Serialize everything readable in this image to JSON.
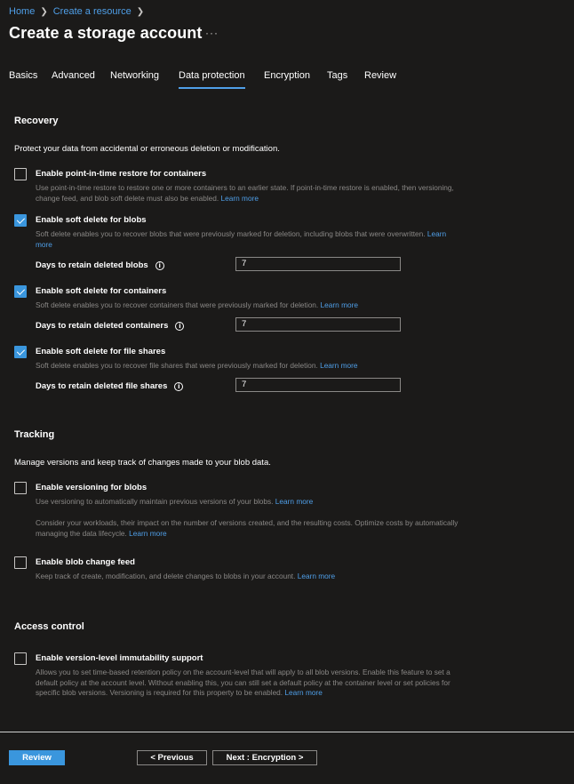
{
  "breadcrumb": {
    "items": [
      "Home",
      "Create a resource"
    ]
  },
  "page": {
    "title": "Create a storage account",
    "more_label": "···"
  },
  "tabs": [
    {
      "label": "Basics"
    },
    {
      "label": "Advanced"
    },
    {
      "label": "Networking"
    },
    {
      "label": "Data protection",
      "active": true
    },
    {
      "label": "Encryption"
    },
    {
      "label": "Tags"
    },
    {
      "label": "Review"
    }
  ],
  "recovery": {
    "heading": "Recovery",
    "description": "Protect your data from accidental or erroneous deletion or modification.",
    "pitr": {
      "label": "Enable point-in-time restore for containers",
      "checked": false,
      "help_line1": "Use point-in-time restore to restore one or more containers to an earlier state. If point-in-time restore is enabled, then versioning,",
      "help_line2": "change feed, and blob soft delete must also be enabled.",
      "learn_more": "Learn more"
    },
    "soft_delete_blobs": {
      "label": "Enable soft delete for blobs",
      "checked": true,
      "help_line1": "Soft delete enables you to recover blobs that were previously marked for deletion, including blobs that were overwritten.",
      "learn_more_1": "Learn",
      "learn_more_2": "more",
      "days_label": "Days to retain deleted blobs",
      "days_value": "7"
    },
    "soft_delete_containers": {
      "label": "Enable soft delete for containers",
      "checked": true,
      "help_line1": "Soft delete enables you to recover containers that were previously marked for deletion.",
      "learn_more": "Learn more",
      "days_label": "Days to retain deleted containers",
      "days_value": "7"
    },
    "soft_delete_shares": {
      "label": "Enable soft delete for file shares",
      "checked": true,
      "help_line1": "Soft delete enables you to recover file shares that were previously marked for deletion.",
      "learn_more": "Learn more",
      "days_label": "Days to retain deleted file shares",
      "days_value": "7"
    }
  },
  "tracking": {
    "heading": "Tracking",
    "description": "Manage versions and keep track of changes made to your blob data.",
    "versioning": {
      "label": "Enable versioning for blobs",
      "checked": false,
      "help_line1": "Use versioning to automatically maintain previous versions of your blobs.",
      "learn_more": "Learn more",
      "note_line1": "Consider your workloads, their impact on the number of versions created, and the resulting costs. Optimize costs by automatically",
      "note_line2": "managing the data lifecycle.",
      "note_learn_more": "Learn more"
    },
    "change_feed": {
      "label": "Enable blob change feed",
      "checked": false,
      "help_line1": "Keep track of create, modification, and delete changes to blobs in your account.",
      "learn_more": "Learn more"
    }
  },
  "access_control": {
    "heading": "Access control",
    "immutability": {
      "label": "Enable version-level immutability support",
      "checked": false,
      "help_line1": "Allows you to set time-based retention policy on the account-level that will apply to all blob versions. Enable this feature to set a",
      "help_line2": "default policy at the account level. Without enabling this, you can still set a default policy at the container level or set policies for",
      "help_line3": "specific blob versions. Versioning is required for this property to be enabled.",
      "learn_more": "Learn more"
    }
  },
  "footer": {
    "review_label": "Review",
    "previous_label": "< Previous",
    "next_label": "Next : Encryption >"
  },
  "colors": {
    "background": "#1b1a19",
    "accent": "#3a96dd",
    "link": "#4f9fe8",
    "muted_text": "#8a8886"
  },
  "icons": {
    "info": "info-icon",
    "chevron": "chevron-right-icon",
    "check": "checkmark-icon"
  }
}
